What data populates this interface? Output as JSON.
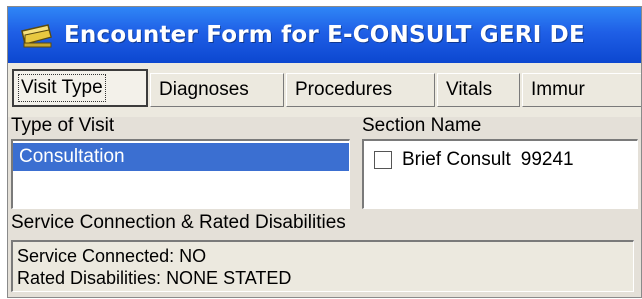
{
  "window": {
    "title": "Encounter Form for E-CONSULT GERI DE"
  },
  "tabs": [
    {
      "label": "Visit Type",
      "active": true
    },
    {
      "label": "Diagnoses",
      "active": false
    },
    {
      "label": "Procedures",
      "active": false
    },
    {
      "label": "Vitals",
      "active": false
    },
    {
      "label": "Immur",
      "active": false
    }
  ],
  "visit_type": {
    "label": "Type of Visit",
    "items": [
      {
        "label": "Consultation",
        "selected": true
      }
    ]
  },
  "section": {
    "label": "Section Name",
    "items": [
      {
        "label": "Brief Consult",
        "code": "99241",
        "checked": false
      }
    ]
  },
  "service": {
    "label": "Service Connection & Rated Disabilities",
    "service_connected": "Service Connected: NO",
    "rated_disabilities": "Rated Disabilities: NONE STATED"
  },
  "colors": {
    "titlebar": "#1f5fe6",
    "selection": "#3b6fd1",
    "panel": "#ece9df"
  }
}
